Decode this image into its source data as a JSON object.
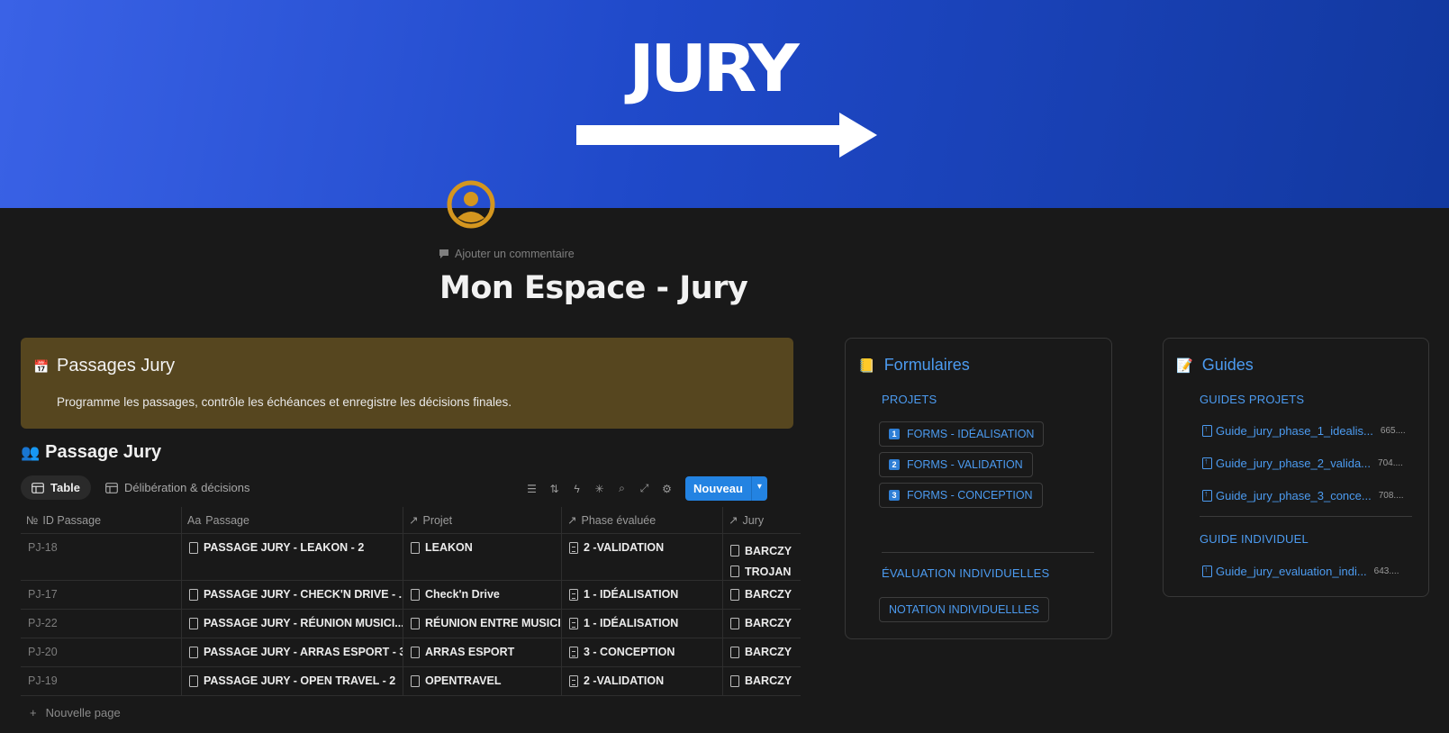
{
  "cover": {
    "title": "JURY",
    "colors": {
      "start": "#3a62e6",
      "end": "#12389f"
    }
  },
  "header": {
    "comment_label": "Ajouter un commentaire",
    "title": "Mon Espace - Jury"
  },
  "callout": {
    "icon": "calendar-icon",
    "title": "Passages Jury",
    "text": "Programme les passages, contrôle les échéances et enregistre les décisions finales."
  },
  "database": {
    "title": "Passage Jury",
    "views": [
      {
        "label": "Table",
        "icon": "table-icon"
      },
      {
        "label": "Délibération & décisions",
        "icon": "table-icon"
      }
    ],
    "new_button": "Nouveau",
    "columns": [
      {
        "label": "ID Passage",
        "icon": "№"
      },
      {
        "label": "Passage",
        "icon": "Aa"
      },
      {
        "label": "Projet",
        "icon": "↗"
      },
      {
        "label": "Phase évaluée",
        "icon": "↗"
      },
      {
        "label": "Jury",
        "icon": "↗"
      }
    ],
    "rows": [
      {
        "id": "PJ-18",
        "passage": "PASSAGE JURY - LEAKON - 2",
        "projet": "LEAKON",
        "phase": "2 -VALIDATION",
        "jury": [
          "BARCZY",
          "TROJAN"
        ]
      },
      {
        "id": "PJ-17",
        "passage": "PASSAGE JURY - CHECK'N DRIVE - ...",
        "projet": "Check'n Drive",
        "phase": "1 - IDÉALISATION",
        "jury": [
          "BARCZY"
        ]
      },
      {
        "id": "PJ-22",
        "passage": "PASSAGE JURY - RÉUNION MUSICI...",
        "projet": "RÉUNION ENTRE MUSICIEN",
        "phase": "1 - IDÉALISATION",
        "jury": [
          "BARCZY"
        ]
      },
      {
        "id": "PJ-20",
        "passage": "PASSAGE JURY - ARRAS ESPORT - 3",
        "projet": "ARRAS ESPORT",
        "phase": "3 - CONCEPTION",
        "jury": [
          "BARCZY"
        ]
      },
      {
        "id": "PJ-19",
        "passage": "PASSAGE JURY - OPEN TRAVEL - 2",
        "projet": "OPENTRAVEL",
        "phase": "2 -VALIDATION",
        "jury": [
          "BARCZY"
        ]
      }
    ],
    "new_page": "Nouvelle page"
  },
  "forms": {
    "title": "Formulaires",
    "section1": "PROJETS",
    "links": [
      {
        "num": "1",
        "label": "FORMS - IDÉALISATION"
      },
      {
        "num": "2",
        "label": "FORMS - VALIDATION"
      },
      {
        "num": "3",
        "label": "FORMS - CONCEPTION"
      }
    ],
    "section2": "ÉVALUATION INDIVIDUELLES",
    "individual_link": "NOTATION INDIVIDUELLLES"
  },
  "guides": {
    "title": "Guides",
    "section1": "GUIDES PROJETS",
    "files": [
      {
        "name": "Guide_jury_phase_1_idealis...",
        "size": "665...."
      },
      {
        "name": "Guide_jury_phase_2_valida...",
        "size": "704...."
      },
      {
        "name": "Guide_jury_phase_3_conce...",
        "size": "708...."
      }
    ],
    "section2": "GUIDE INDIVIDUEL",
    "individual_file": {
      "name": "Guide_jury_evaluation_indi...",
      "size": "643...."
    }
  }
}
